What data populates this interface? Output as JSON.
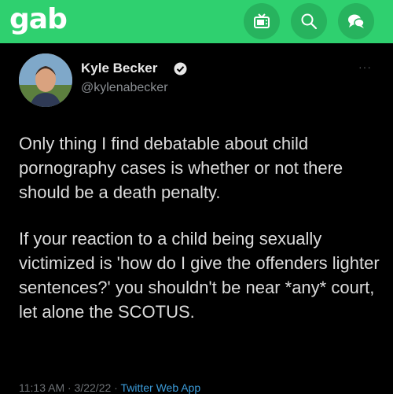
{
  "header": {
    "logo": "gab",
    "buttons": [
      {
        "name": "tv-icon"
      },
      {
        "name": "search-icon"
      },
      {
        "name": "chat-icon"
      }
    ],
    "colors": {
      "brand": "#2fd06f",
      "button": "#27b35e"
    }
  },
  "tweet": {
    "author_name": "Kyle Becker",
    "handle": "@kylenabecker",
    "more": "···",
    "paragraphs": [
      "Only thing I find debatable about child pornography cases is whether or not there should be a death penalty.",
      "If your reaction to a child being sexually victimized is 'how do I give the offenders lighter sentences?' you shouldn't be near *any* court, let alone the SCOTUS."
    ],
    "footer_time": "11:13 AM · 3/22/22 · ",
    "footer_source": "Twitter Web App"
  }
}
